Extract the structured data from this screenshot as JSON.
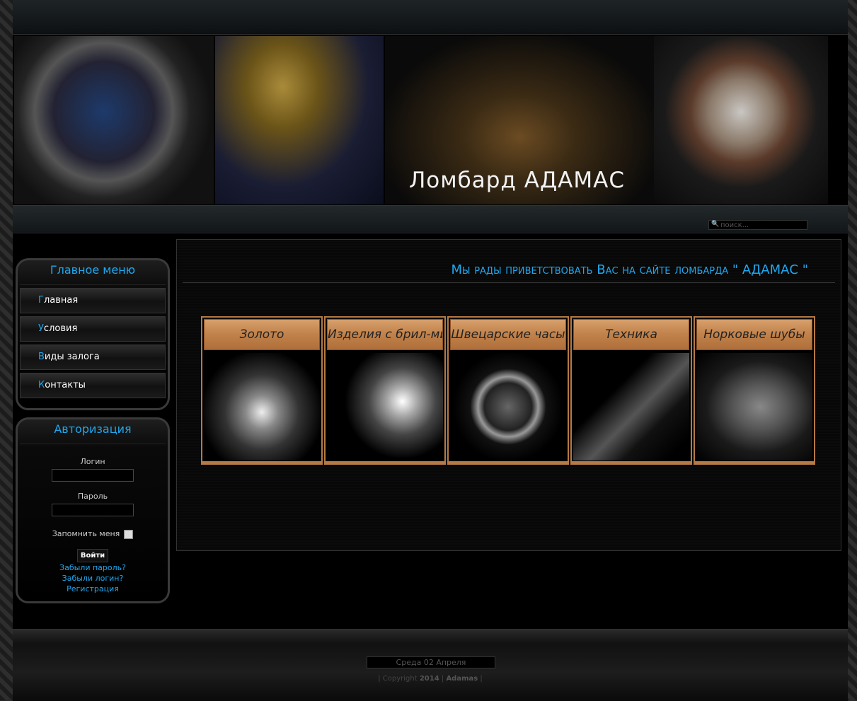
{
  "banner": {
    "title": "Ломбард АДАМАС"
  },
  "search": {
    "placeholder": "поиск..."
  },
  "menu": {
    "title": "Главное меню",
    "items": [
      {
        "first": "Г",
        "rest": "лавная"
      },
      {
        "first": "У",
        "rest": "словия"
      },
      {
        "first": "В",
        "rest": "иды залога"
      },
      {
        "first": "К",
        "rest": "онтакты"
      }
    ]
  },
  "auth": {
    "title": "Авторизация",
    "login_label": "Логин",
    "password_label": "Пароль",
    "remember_label": "Запомнить меня",
    "submit": "Войти",
    "forgot_password": "Забыли пароль?",
    "forgot_login": "Забыли логин?",
    "register": "Регистрация"
  },
  "main": {
    "welcome": "Мы рады приветствовать Вас на сайте ломбарда \" АДАМАС \"",
    "categories": [
      {
        "label": "Золото"
      },
      {
        "label": "Изделия с брил-ми"
      },
      {
        "label": "Швецарские часы"
      },
      {
        "label": "Техника"
      },
      {
        "label": "Норковые шубы"
      }
    ]
  },
  "footer": {
    "date": "Среда 02 Апреля",
    "copyright_prefix": "| Copyright",
    "year": "2014",
    "sep": "|",
    "brand": "Adamas",
    "copyright_suffix": "|"
  }
}
